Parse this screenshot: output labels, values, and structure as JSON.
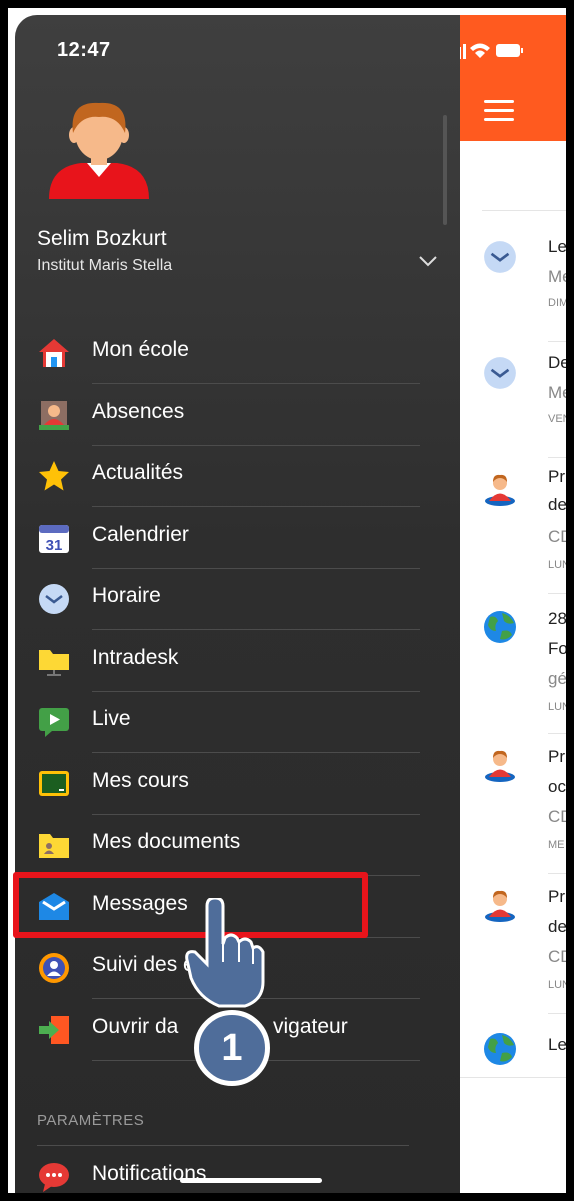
{
  "status_bar": {
    "time": "12:47"
  },
  "user": {
    "name": "Selim Bozkurt",
    "school": "Institut Maris Stella"
  },
  "menu": {
    "items": [
      {
        "label": "Mon école",
        "icon": "house-icon"
      },
      {
        "label": "Absences",
        "icon": "person-card-icon"
      },
      {
        "label": "Actualités",
        "icon": "star-icon"
      },
      {
        "label": "Calendrier",
        "icon": "calendar-icon",
        "icon_text": "31"
      },
      {
        "label": "Horaire",
        "icon": "clock-icon"
      },
      {
        "label": "Intradesk",
        "icon": "desk-folder-icon"
      },
      {
        "label": "Live",
        "icon": "live-play-icon"
      },
      {
        "label": "Mes cours",
        "icon": "chalkboard-icon"
      },
      {
        "label": "Mes documents",
        "icon": "documents-folder-icon"
      },
      {
        "label": "Messages",
        "icon": "envelope-icon"
      },
      {
        "label": "Suivi des é",
        "icon": "student-tracking-icon"
      },
      {
        "label": "Ouvrir da",
        "label_tail": "vigateur",
        "icon": "open-browser-icon"
      }
    ],
    "settings_section": "PARAMÈTRES",
    "settings_items": [
      {
        "label": "Notifications",
        "icon": "speech-bubble-icon"
      }
    ]
  },
  "annotation": {
    "step": "1"
  },
  "feed": {
    "items": [
      {
        "icon": "clock-icon",
        "line1": "Le",
        "line2": "Me",
        "line3": "",
        "date": "DIM"
      },
      {
        "icon": "clock-icon",
        "line1": "De",
        "line2": "Me",
        "line3": "",
        "date": "VEN"
      },
      {
        "icon": "person-icon",
        "line1": "Pr",
        "line2": "de",
        "line3": "CD",
        "date": "LUN"
      },
      {
        "icon": "globe-icon",
        "line1": "28",
        "line2": "Fo",
        "line3": "gé",
        "date": "LUN"
      },
      {
        "icon": "person-icon",
        "line1": "Pr",
        "line2": "oc",
        "line3": "CD",
        "date": "ME"
      },
      {
        "icon": "person-icon",
        "line1": "Pr",
        "line2": "de",
        "line3": "CD",
        "date": "LUN"
      },
      {
        "icon": "globe-icon",
        "line1": "Le",
        "line2": "",
        "line3": "",
        "date": ""
      }
    ]
  },
  "colors": {
    "accent": "#ff5a1f",
    "highlight": "#e8141b",
    "drawer_bg": "#333333",
    "badge": "#4f6d9a"
  }
}
